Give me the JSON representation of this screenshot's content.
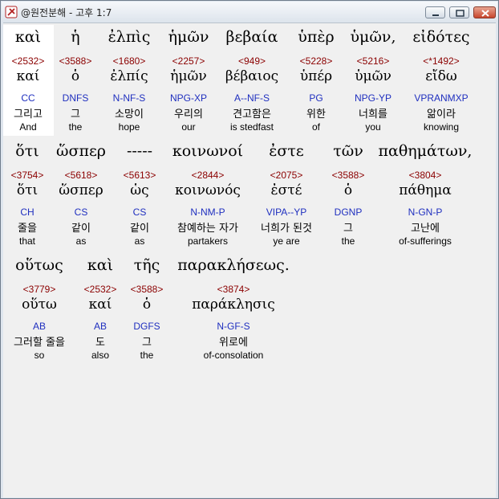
{
  "window": {
    "title": "@원전분해 - 고후 1:7"
  },
  "colors": {
    "strongs": "#8b0000",
    "parsing": "#1f2fbf",
    "text": "#000000"
  },
  "rows": [
    [
      {
        "greek": "καὶ",
        "strongs": "<2532>",
        "lexeme": "καί",
        "parsing": "CC",
        "korean": "그리고",
        "english": "And"
      },
      {
        "greek": "ἡ",
        "strongs": "<3588>",
        "lexeme": "ὁ",
        "parsing": "DNFS",
        "korean": "그",
        "english": "the"
      },
      {
        "greek": "ἐλπὶς",
        "strongs": "<1680>",
        "lexeme": "ἐλπίς",
        "parsing": "N-NF-S",
        "korean": "소망이",
        "english": "hope"
      },
      {
        "greek": "ἡμῶν",
        "strongs": "<2257>",
        "lexeme": "ἡμῶν",
        "parsing": "NPG-XP",
        "korean": "우리의",
        "english": "our"
      },
      {
        "greek": "βεβαία",
        "strongs": "<949>",
        "lexeme": "βέβαιος",
        "parsing": "A--NF-S",
        "korean": "견고함은",
        "english": "is stedfast"
      },
      {
        "greek": "ὑπὲρ",
        "strongs": "<5228>",
        "lexeme": "ὑπέρ",
        "parsing": "PG",
        "korean": "위한",
        "english": "of"
      },
      {
        "greek": "ὑμῶν,",
        "strongs": "<5216>",
        "lexeme": "ὑμῶν",
        "parsing": "NPG-YP",
        "korean": "너희를",
        "english": "you"
      },
      {
        "greek": "εἰδότες",
        "strongs": "<*1492>",
        "lexeme": "εἴδω",
        "parsing": "VPRANMXP",
        "korean": "앎이라",
        "english": "knowing"
      }
    ],
    [
      {
        "greek": "ὅτι",
        "strongs": "<3754>",
        "lexeme": "ὅτι",
        "parsing": "CH",
        "korean": "줄을",
        "english": "that"
      },
      {
        "greek": "ὥσπερ",
        "strongs": "<5618>",
        "lexeme": "ὥσπερ",
        "parsing": "CS",
        "korean": "같이",
        "english": "as"
      },
      {
        "greek": "-----",
        "strongs": "<5613>",
        "lexeme": "ὡς",
        "parsing": "CS",
        "korean": "같이",
        "english": "as"
      },
      {
        "greek": "κοινωνοί",
        "strongs": "<2844>",
        "lexeme": "κοινωνός",
        "parsing": "N-NM-P",
        "korean": "참예하는 자가",
        "english": "partakers"
      },
      {
        "greek": "ἐστε",
        "strongs": "<2075>",
        "lexeme": "ἐστέ",
        "parsing": "VIPA--YP",
        "korean": "너희가 된것",
        "english": "ye are"
      },
      {
        "greek": "τῶν",
        "strongs": "<3588>",
        "lexeme": "ὁ",
        "parsing": "DGNP",
        "korean": "그",
        "english": "the"
      },
      {
        "greek": "παθημάτων,",
        "strongs": "<3804>",
        "lexeme": "πάθημα",
        "parsing": "N-GN-P",
        "korean": "고난에",
        "english": "of-sufferings"
      }
    ],
    [
      {
        "greek": "οὕτως",
        "strongs": "<3779>",
        "lexeme": "οὕτω",
        "parsing": "AB",
        "korean": "그러할 줄을",
        "english": "so"
      },
      {
        "greek": "καὶ",
        "strongs": "<2532>",
        "lexeme": "καί",
        "parsing": "AB",
        "korean": "도",
        "english": "also"
      },
      {
        "greek": "τῆς",
        "strongs": "<3588>",
        "lexeme": "ὁ",
        "parsing": "DGFS",
        "korean": "그",
        "english": "the"
      },
      {
        "greek": "παρακλήσεως.",
        "strongs": "<3874>",
        "lexeme": "παράκλησις",
        "parsing": "N-GF-S",
        "korean": "위로에",
        "english": "of-consolation"
      }
    ]
  ]
}
